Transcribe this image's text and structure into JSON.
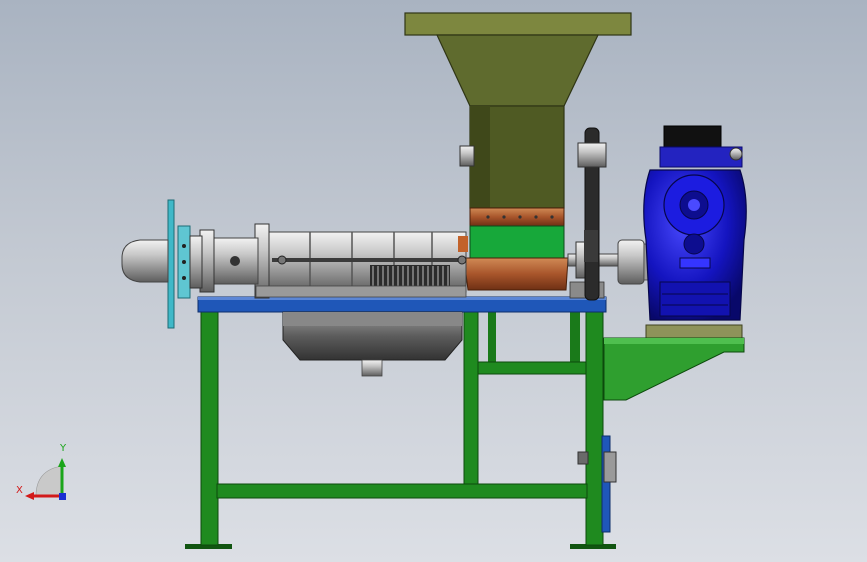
{
  "triad": {
    "x_label": "X",
    "y_label": "Y",
    "x_color": "#d21a1a",
    "y_color": "#1aa51a",
    "z_color": "#1a2fd2"
  },
  "colors": {
    "frame": "#1f8a1f",
    "frame_dark": "#115511",
    "hopper": "#5f6b2e",
    "hopper_rim": "#7d873f",
    "feed_throat": "#17a83a",
    "copper": "#b4663a",
    "motor": "#1616c8",
    "motor_dark": "#0b0b7a",
    "beam": "#1f57b8",
    "steel": "#c9c9c9",
    "steel_dark": "#6e6e6e",
    "cyan_wheel": "#3fb8c8",
    "chute": "#2f9f2f"
  }
}
